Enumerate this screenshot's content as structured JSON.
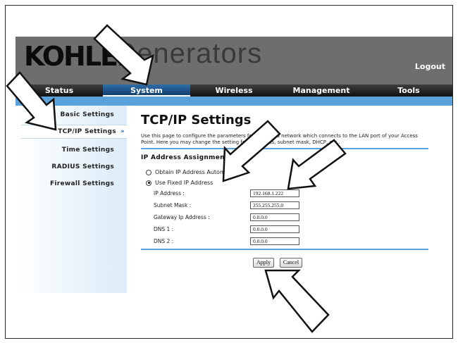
{
  "brand": {
    "logo_bold": "KOHLER",
    "logo_light": "Generators"
  },
  "header": {
    "logout_label": "Logout"
  },
  "nav": {
    "items": [
      "Status",
      "System",
      "Wireless",
      "Management",
      "Tools"
    ],
    "active": "System"
  },
  "sidebar": {
    "items": [
      "Basic Settings",
      "TCP/IP Settings",
      "Time Settings",
      "RADIUS Settings",
      "Firewall Settings"
    ],
    "active": "TCP/IP Settings",
    "active_marker": "»"
  },
  "main": {
    "title": "TCP/IP Settings",
    "description": "Use this page to configure the parameters for local area network which connects to the LAN port of your Access Point. Here you may change the setting for IP address, subnet mask, DHCP, etc..",
    "section_title": "IP Address Assignment",
    "radio_options": [
      {
        "label": "Obtain IP Address Automatically",
        "checked": false
      },
      {
        "label": "Use Fixed IP Address",
        "checked": true
      }
    ],
    "fields": [
      {
        "label": "IP Address :",
        "value": "192.168.1.222"
      },
      {
        "label": "Subnet Mask :",
        "value": "255.255.255.0"
      },
      {
        "label": "Gateway Ip Address :",
        "value": "0.0.0.0"
      },
      {
        "label": "DNS 1 :",
        "value": "0.0.0.0"
      },
      {
        "label": "DNS 2 :",
        "value": "0.0.0.0"
      }
    ],
    "apply_label": "Apply",
    "cancel_label": "Cancel"
  },
  "colors": {
    "accent": "#5aa2dc",
    "header_bg": "#6e6e6e",
    "nav_active": "#1f5a92"
  },
  "icons": {
    "annotation": "arrow-pointer-icon"
  }
}
